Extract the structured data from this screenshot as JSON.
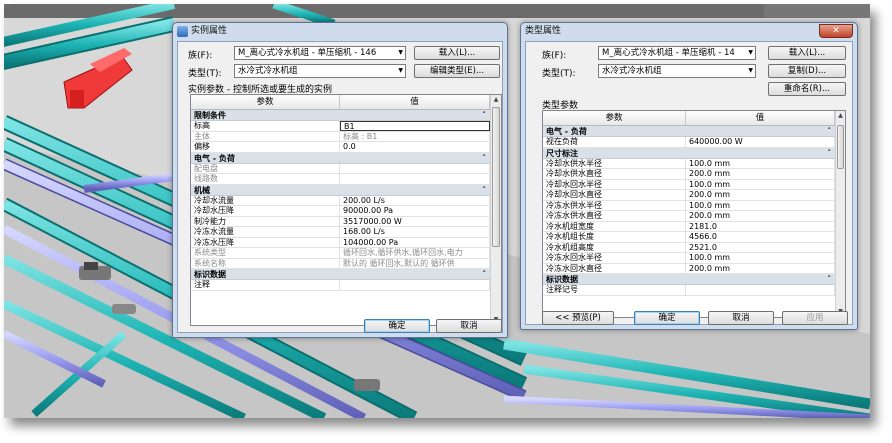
{
  "instance_dialog": {
    "title": "实例属性",
    "family_label": "族(F):",
    "family_value": "M_离心式冷水机组 - 单压缩机 - 146",
    "type_label": "类型(T):",
    "type_value": "水冷式冷水机组",
    "load_button": "载入(L)...",
    "edit_type_button": "编辑类型(E)...",
    "caption": "实例参数 - 控制所选或要生成的实例",
    "col_param": "参数",
    "col_value": "值",
    "sections": [
      {
        "title": "限制条件",
        "rows": [
          {
            "param": "标高",
            "value": "B1",
            "grey": false,
            "selected": true
          },
          {
            "param": "主体",
            "value": "标高 : B1",
            "grey": true
          },
          {
            "param": "偏移",
            "value": "0.0",
            "grey": false
          }
        ]
      },
      {
        "title": "电气 - 负荷",
        "rows": [
          {
            "param": "配电盘",
            "value": "",
            "grey": true
          },
          {
            "param": "线路数",
            "value": "",
            "grey": true
          }
        ]
      },
      {
        "title": "机械",
        "rows": [
          {
            "param": "冷却水流量",
            "value": "200.00 L/s",
            "grey": false
          },
          {
            "param": "冷却水压降",
            "value": "90000.00 Pa",
            "grey": false
          },
          {
            "param": "制冷能力",
            "value": "3517000.00 W",
            "grey": false
          },
          {
            "param": "冷冻水流量",
            "value": "168.00 L/s",
            "grey": false
          },
          {
            "param": "冷冻水压降",
            "value": "104000.00 Pa",
            "grey": false
          },
          {
            "param": "系统类型",
            "value": "循环回水,循环供水,循环回水,电力",
            "grey": true
          },
          {
            "param": "系统名称",
            "value": "默认的 循环回水,默认的 循环供",
            "grey": true
          }
        ]
      },
      {
        "title": "标识数据",
        "rows": [
          {
            "param": "注释",
            "value": "",
            "grey": false
          }
        ]
      }
    ],
    "ok_button": "确定",
    "cancel_button": "取消",
    "close_glyph": "✕"
  },
  "type_dialog": {
    "title": "类型属性",
    "family_label": "族(F):",
    "family_value": "M_离心式冷水机组 - 单压缩机 - 14",
    "type_label": "类型(T):",
    "type_value": "水冷式冷水机组",
    "load_button": "载入(L)...",
    "duplicate_button": "复制(D)...",
    "rename_button": "重命名(R)...",
    "caption": "类型参数",
    "col_param": "参数",
    "col_value": "值",
    "sections": [
      {
        "title": "电气 - 负荷",
        "rows": [
          {
            "param": "视在负荷",
            "value": "640000.00 W",
            "grey": false
          }
        ]
      },
      {
        "title": "尺寸标注",
        "rows": [
          {
            "param": "冷却水供水半径",
            "value": "100.0 mm",
            "grey": false
          },
          {
            "param": "冷却水供水直径",
            "value": "200.0 mm",
            "grey": false
          },
          {
            "param": "冷却水回水半径",
            "value": "100.0 mm",
            "grey": false
          },
          {
            "param": "冷却水回水直径",
            "value": "200.0 mm",
            "grey": false
          },
          {
            "param": "冷冻水供水半径",
            "value": "100.0 mm",
            "grey": false
          },
          {
            "param": "冷冻水供水直径",
            "value": "200.0 mm",
            "grey": false
          },
          {
            "param": "冷水机组宽度",
            "value": "2181.0",
            "grey": false
          },
          {
            "param": "冷水机组长度",
            "value": "4566.0",
            "grey": false
          },
          {
            "param": "冷水机组高度",
            "value": "2521.0",
            "grey": false
          },
          {
            "param": "冷冻水回水半径",
            "value": "100.0 mm",
            "grey": false
          },
          {
            "param": "冷冻水回水直径",
            "value": "200.0 mm",
            "grey": false
          }
        ]
      },
      {
        "title": "标识数据",
        "rows": [
          {
            "param": "注释记号",
            "value": "",
            "grey": false
          }
        ]
      }
    ],
    "preview_button": "<< 预览(P)",
    "ok_button": "确定",
    "cancel_button": "取消",
    "apply_button": "应用",
    "close_glyph": "✕"
  },
  "colors": {
    "pipe_teal": "#1fb5b5",
    "pipe_dark_teal": "#0f8c8c",
    "pipe_lavender": "#9a9cf0",
    "chiller_red": "#f03a3a",
    "floor_grey": "#dcdcdc",
    "titlebar_blue": "#cfdceb"
  }
}
